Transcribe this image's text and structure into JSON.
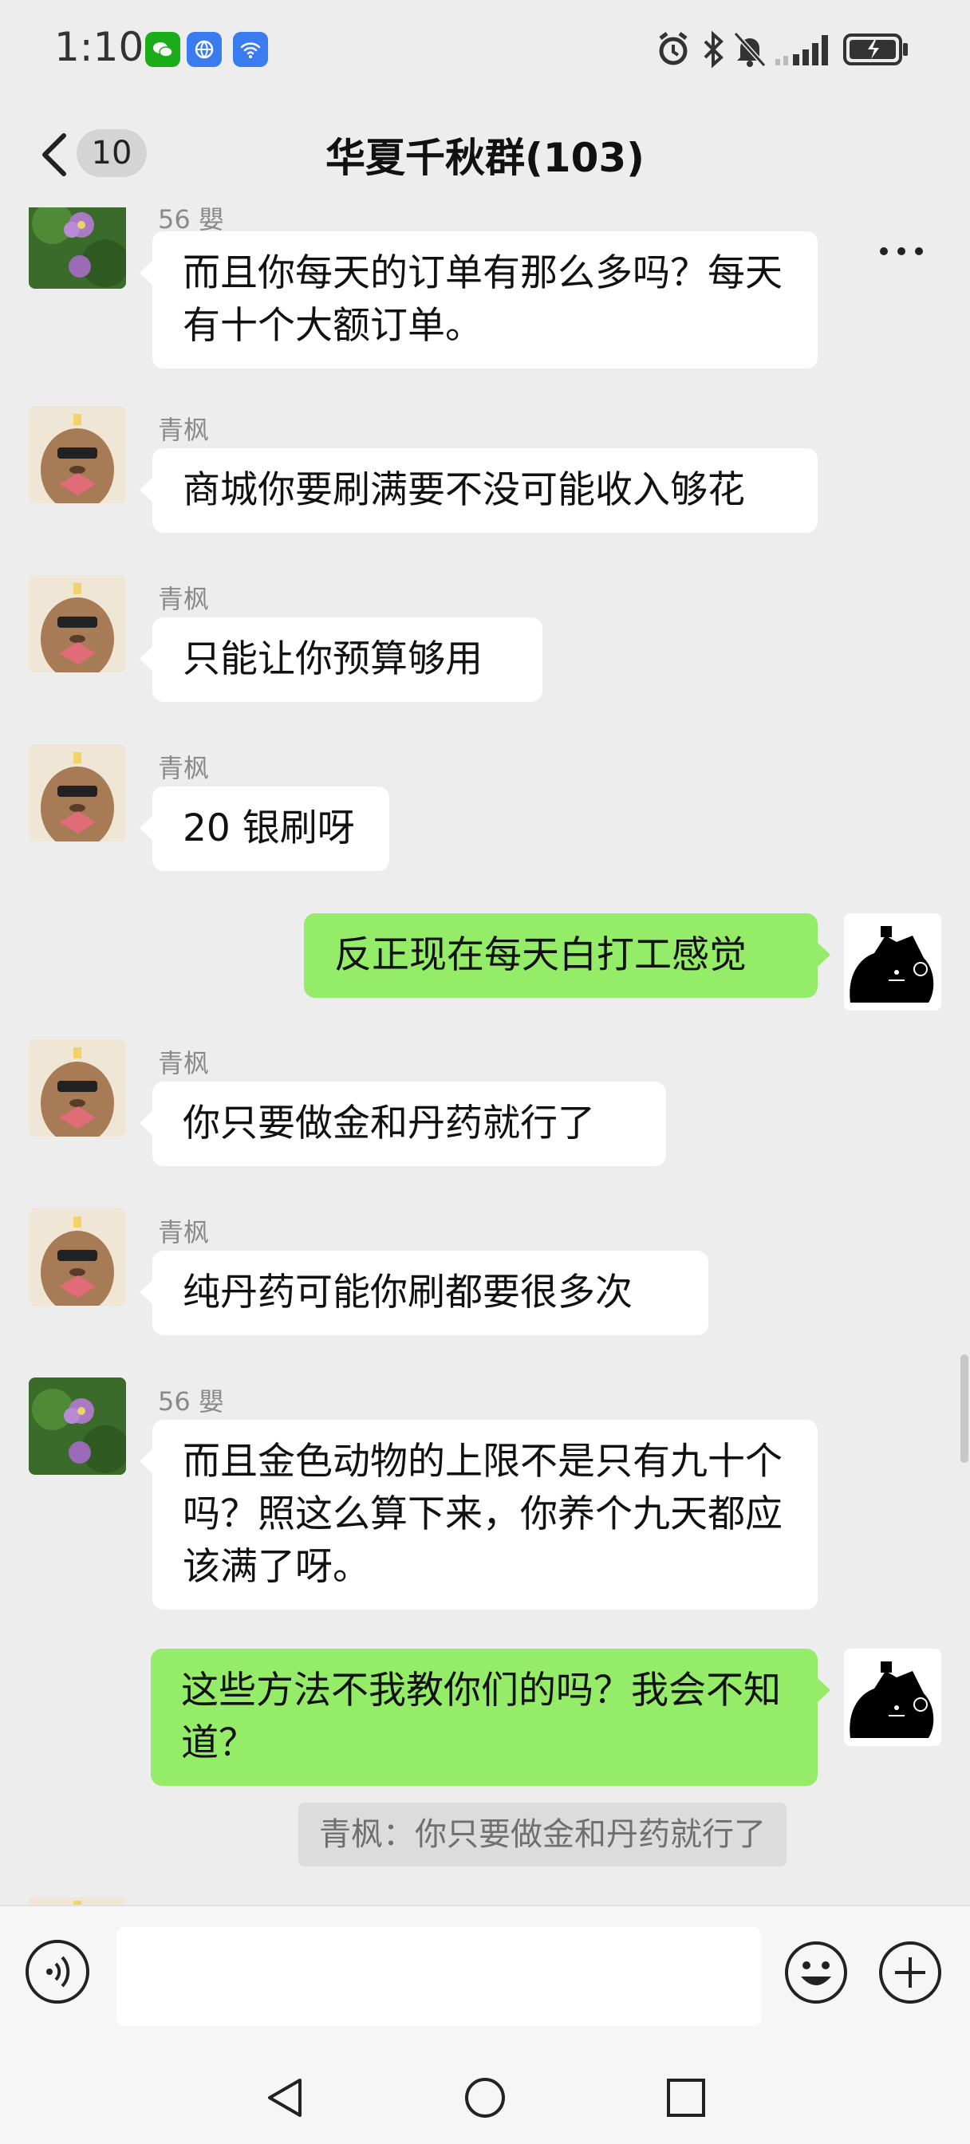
{
  "status_bar": {
    "time": "1:10"
  },
  "header": {
    "unread_count": "10",
    "title": "华夏千秋群(103)"
  },
  "messages": [
    {
      "side": "left",
      "sender": "56 嬰",
      "text": "而且你每天的订单有那么多吗？每天有十个大额订单。"
    },
    {
      "side": "left",
      "sender": "青枫",
      "text": "商城你要刷满要不没可能收入够花"
    },
    {
      "side": "left",
      "sender": "青枫",
      "text": "只能让你预算够用"
    },
    {
      "side": "left",
      "sender": "青枫",
      "text": "20 银刷呀"
    },
    {
      "side": "right",
      "sender": "",
      "text": "反正现在每天白打工感觉"
    },
    {
      "side": "left",
      "sender": "青枫",
      "text": "你只要做金和丹药就行了"
    },
    {
      "side": "left",
      "sender": "青枫",
      "text": "纯丹药可能你刷都要很多次"
    },
    {
      "side": "left",
      "sender": "56 嬰",
      "text": "而且金色动物的上限不是只有九十个吗？照这么算下来，你养个九天都应该满了呀。"
    },
    {
      "side": "right",
      "sender": "",
      "text": "这些方法不我教你们的吗？我会不知道？",
      "quote": "青枫：你只要做金和丹药就行了"
    }
  ],
  "colors": {
    "accent_green": "#95ec69",
    "background": "#ededed"
  }
}
